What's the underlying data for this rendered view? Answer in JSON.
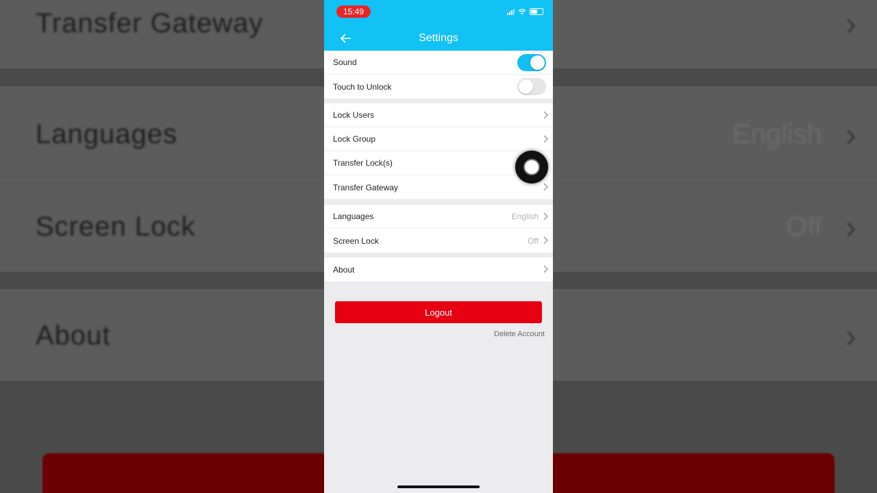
{
  "background": {
    "rows": [
      {
        "label": "Transfer Gateway",
        "value": ""
      },
      {
        "label": "Languages",
        "value": "English"
      },
      {
        "label": "Screen Lock",
        "value": "Off"
      },
      {
        "label": "About",
        "value": ""
      }
    ]
  },
  "status_bar": {
    "time": "15:49"
  },
  "header": {
    "title": "Settings"
  },
  "toggles": [
    {
      "label": "Sound",
      "on": true
    },
    {
      "label": "Touch to Unlock",
      "on": false
    }
  ],
  "menu_group_1": [
    {
      "label": "Lock Users"
    },
    {
      "label": "Lock Group"
    },
    {
      "label": "Transfer Lock(s)"
    },
    {
      "label": "Transfer Gateway"
    }
  ],
  "menu_group_2": [
    {
      "label": "Languages",
      "value": "English"
    },
    {
      "label": "Screen Lock",
      "value": "Off"
    }
  ],
  "menu_group_3": [
    {
      "label": "About"
    }
  ],
  "actions": {
    "logout_label": "Logout",
    "delete_account_label": "Delete Account"
  },
  "colors": {
    "header": "#12c2f4",
    "logout": "#e60012",
    "toggle_on": "#14bdf2"
  }
}
